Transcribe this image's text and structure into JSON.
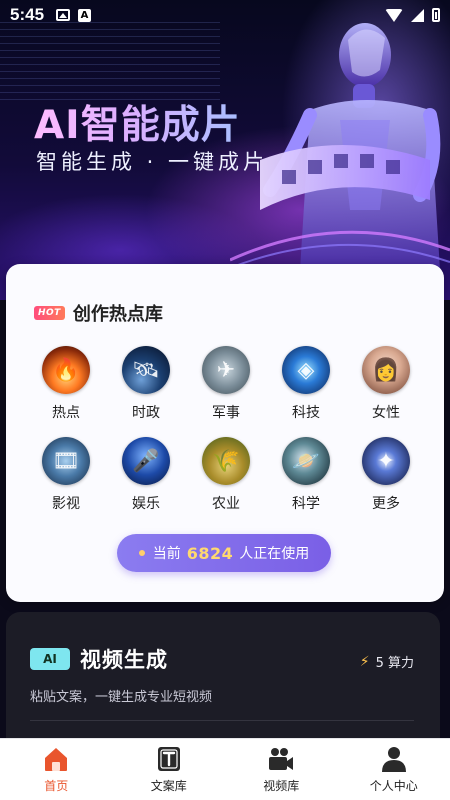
{
  "status_bar": {
    "time": "5:45"
  },
  "hero": {
    "title": "AI智能成片",
    "subtitle": "智能生成 · 一键成片"
  },
  "hot": {
    "badge": "HOT",
    "title": "创作热点库",
    "categories": [
      {
        "label": "热点",
        "icon": "fire-icon"
      },
      {
        "label": "时政",
        "icon": "satellite-icon"
      },
      {
        "label": "军事",
        "icon": "fighter-jet-icon"
      },
      {
        "label": "科技",
        "icon": "tech-circuit-icon"
      },
      {
        "label": "女性",
        "icon": "woman-portrait-icon"
      },
      {
        "label": "影视",
        "icon": "film-reel-icon"
      },
      {
        "label": "娱乐",
        "icon": "microphone-icon"
      },
      {
        "label": "农业",
        "icon": "wheat-icon"
      },
      {
        "label": "科学",
        "icon": "planet-icon"
      },
      {
        "label": "更多",
        "icon": "galaxy-icon"
      }
    ],
    "usage": {
      "prefix": "当前",
      "count": "6824",
      "suffix": "人正在使用"
    }
  },
  "video": {
    "badge": "AI",
    "title": "视频生成",
    "power": "5 算力",
    "description": "粘贴文案，一键生成专业短视频"
  },
  "tabs": [
    {
      "label": "首页",
      "icon": "home-icon",
      "active": true
    },
    {
      "label": "文案库",
      "icon": "text-doc-icon",
      "active": false
    },
    {
      "label": "视频库",
      "icon": "video-camera-icon",
      "active": false
    },
    {
      "label": "个人中心",
      "icon": "user-icon",
      "active": false
    }
  ],
  "colors": {
    "accent": "#7a5fe6",
    "tab_active": "#e9552d",
    "usage_number": "#ffd970",
    "ai_badge": "#7ee6ef",
    "hot_badge": "#ff4d7d"
  }
}
